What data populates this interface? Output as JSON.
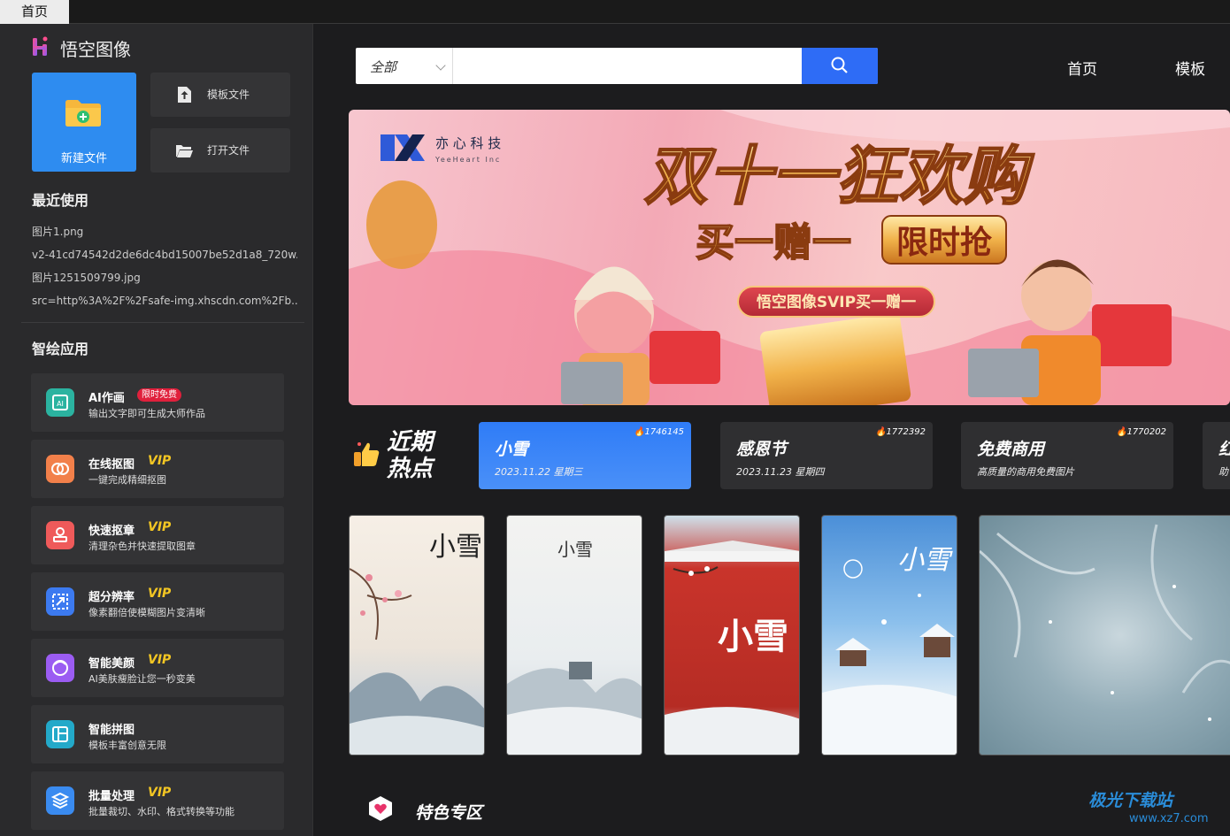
{
  "tabbar": {
    "tab_label": "首页"
  },
  "sidebar": {
    "app_title": "悟空图像",
    "new_file_label": "新建文件",
    "template_file_label": "模板文件",
    "open_file_label": "打开文件",
    "recent_title": "最近使用",
    "recent_files": [
      "图片1.png",
      "v2-41cd74542d2de6dc4bd15007be52d1a8_720w...",
      "图片1251509799.jpg",
      "src=http%3A%2F%2Fsafe-img.xhscdn.com%2Fb..."
    ],
    "apps_title": "智绘应用",
    "apps": [
      {
        "name": "AI作画",
        "desc": "输出文字即可生成大师作品",
        "badge": "限时免费",
        "icon": "ai-paint-icon",
        "color": "#2bb3a0"
      },
      {
        "name": "在线抠图",
        "desc": "一键完成精细抠图",
        "badge": "VIP",
        "icon": "cutout-icon",
        "color": "#f2804a"
      },
      {
        "name": "快速抠章",
        "desc": "清理杂色并快速提取图章",
        "badge": "VIP",
        "icon": "stamp-icon",
        "color": "#ef5a5a"
      },
      {
        "name": "超分辨率",
        "desc": "像素翻倍使模糊图片变清晰",
        "badge": "VIP",
        "icon": "super-resolution-icon",
        "color": "#3c7af0"
      },
      {
        "name": "智能美颜",
        "desc": "AI美肤瘦脸让您一秒变美",
        "badge": "VIP",
        "icon": "beauty-icon",
        "color": "#9b5cf2"
      },
      {
        "name": "智能拼图",
        "desc": "模板丰富创意无限",
        "badge": "",
        "icon": "collage-icon",
        "color": "#23a9c9"
      },
      {
        "name": "批量处理",
        "desc": "批量裁切、水印、格式转换等功能",
        "badge": "VIP",
        "icon": "batch-icon",
        "color": "#3a8bf0"
      }
    ]
  },
  "header": {
    "search_scope": "全部",
    "search_placeholder": "",
    "nav_home": "首页",
    "nav_template": "模板"
  },
  "banner": {
    "brand_cn": "亦 心 科 技",
    "brand_en": "YeeHeart Inc",
    "headline": "双十一狂欢购",
    "sub_left": "买一赠一",
    "sub_right": "限时抢",
    "ribbon": "悟空图像SVIP买一赠一"
  },
  "hot": {
    "title_line1": "近期",
    "title_line2": "热点",
    "cards": [
      {
        "name": "小雪",
        "date": "2023.11.22 星期三",
        "count": "1746145"
      },
      {
        "name": "感恩节",
        "date": "2023.11.23 星期四",
        "count": "1772392"
      },
      {
        "name": "免费商用",
        "date": "高质量的商用免费图片",
        "count": "1770202"
      },
      {
        "name": "红",
        "date": "助",
        "count": ""
      }
    ]
  },
  "posters": [
    {
      "text": "小雪"
    },
    {
      "text": "小雪"
    },
    {
      "text": "小雪"
    },
    {
      "text": "小雪"
    }
  ],
  "feature": {
    "title": "特色专区"
  },
  "watermark": {
    "main": "极光下载站",
    "sub": "www.xz7.com"
  }
}
